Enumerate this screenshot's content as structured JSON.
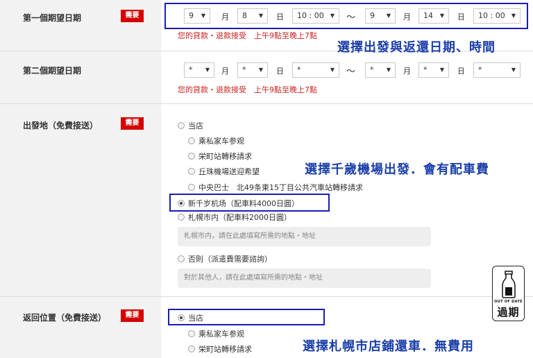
{
  "rows": {
    "date1": {
      "label": "第一個期望日期",
      "required": "需要"
    },
    "date2": {
      "label": "第二個期望日期"
    },
    "departure": {
      "label": "出發地（免費接送）",
      "required": "需要"
    },
    "return": {
      "label": "返回位置（免費接送）",
      "required": "需要"
    }
  },
  "date1": {
    "from_month": "9",
    "month_unit": "月",
    "from_day": "8",
    "day_unit": "日",
    "from_time": "10 : 00",
    "tilde": "～",
    "to_month": "9",
    "to_day": "14",
    "to_time": "10 : 00",
    "note": "您的貸款・退款接受　上午9點至晚上7點"
  },
  "date2": {
    "from_month": "*",
    "month_unit": "月",
    "from_day": "*",
    "day_unit": "日",
    "from_time": "*",
    "tilde": "～",
    "to_month": "*",
    "to_day": "*",
    "to_time": "*",
    "note": "您的貸款・退款接受　上午9點至晚上7點"
  },
  "departure": {
    "options": [
      "当店",
      "乘私家车参观",
      "栄町站轉移請求",
      "丘珠機場送迎希望",
      "中央巴士　北49条東15丁目公共汽車站轉移請求",
      "新千岁机场（配車料4000日圓）",
      "札幌市内（配車料2000日圓）",
      "否則（派遣費需要諮詢）"
    ],
    "selected_index": 5,
    "sapporo_placeholder": "札幌市内，請在此處填寫所需的地點・地址",
    "other_placeholder": "對於其他人，請在此處填寫所需的地點・地址"
  },
  "return": {
    "options": [
      "当店",
      "乘私家车参观",
      "栄町站轉移請求"
    ],
    "selected_index": 0
  },
  "annotations": {
    "a1": "選擇出發與返還日期、時間",
    "a2": "選擇千歲機場出發．會有配車費",
    "a3": "選擇札幌市店鋪還車．無費用"
  },
  "expired_badge": {
    "small": "OUT OF DATE",
    "big": "過期"
  },
  "colors": {
    "required_bg": "#d40000",
    "note": "#cc2222",
    "highlight": "#1a1ab8",
    "annotation": "#1a3ea8",
    "label_bg": "#f2f2f2"
  },
  "icons": {
    "dropdown": "triangle-down",
    "expired": "milk-bottle-icon"
  }
}
